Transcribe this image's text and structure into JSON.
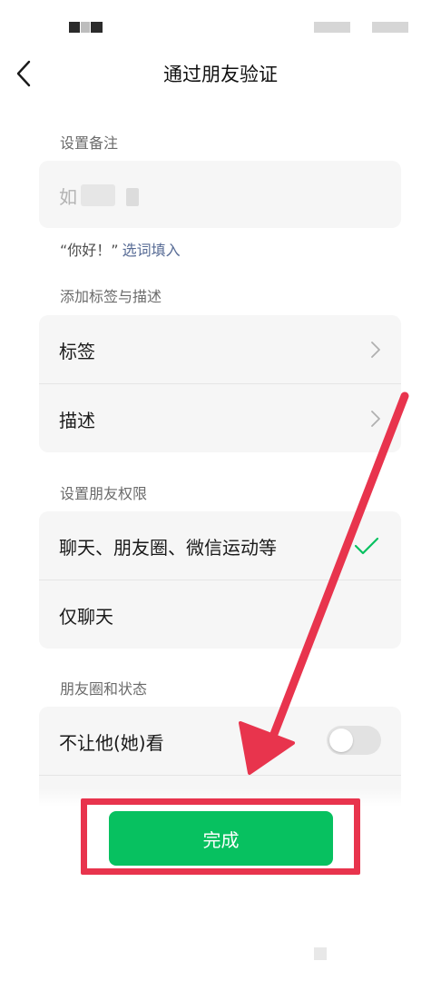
{
  "header": {
    "title": "通过朋友验证"
  },
  "remark_section": {
    "label": "设置备注",
    "input_value": "如",
    "hint_quote": "“你好！”",
    "hint_link": "选词填入"
  },
  "tags_section": {
    "label": "添加标签与描述",
    "items": [
      {
        "label": "标签"
      },
      {
        "label": "描述"
      }
    ]
  },
  "permission_section": {
    "label": "设置朋友权限",
    "options": [
      {
        "label": "聊天、朋友圈、微信运动等",
        "selected": true
      },
      {
        "label": "仅聊天",
        "selected": false
      }
    ]
  },
  "moments_section": {
    "label": "朋友圈和状态",
    "items": [
      {
        "label": "不让他(她)看",
        "enabled": false
      }
    ]
  },
  "footer": {
    "done_label": "完成"
  },
  "colors": {
    "primary_green": "#07c160",
    "link_blue": "#576b95",
    "annotation_red": "#e8344d"
  }
}
